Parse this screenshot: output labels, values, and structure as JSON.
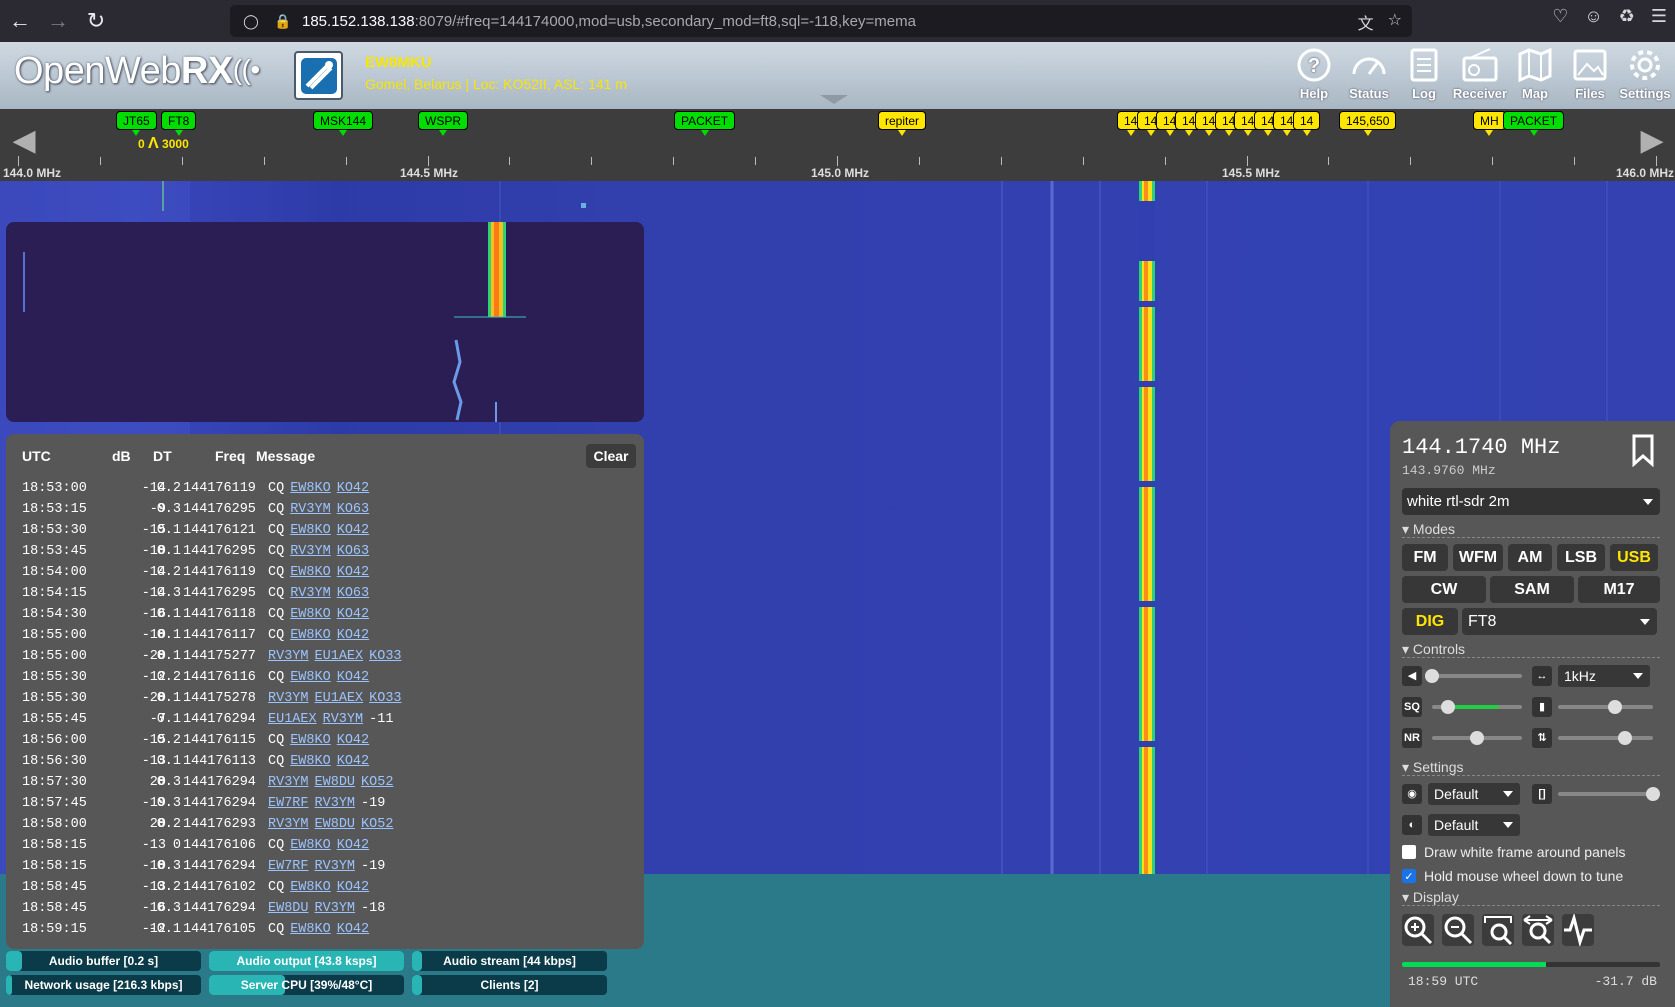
{
  "browser": {
    "url_host": "185.152.138.138",
    "url_rest": ":8079/#freq=144174000,mod=usb,secondary_mod=ft8,sql=-118,key=mema"
  },
  "header": {
    "logo_open": "Open",
    "logo_web": "Web",
    "logo_rx": "RX",
    "receiver_name": "EW8MKU",
    "receiver_location": "Gomel, Belarus | Loc: KO52II, ASL: 141 m",
    "buttons": [
      {
        "label": "Help",
        "icon": "help-icon"
      },
      {
        "label": "Status",
        "icon": "status-gauge-icon"
      },
      {
        "label": "Log",
        "icon": "log-icon"
      },
      {
        "label": "Receiver",
        "icon": "receiver-radio-icon"
      },
      {
        "label": "Map",
        "icon": "map-icon"
      },
      {
        "label": "Files",
        "icon": "files-image-icon"
      },
      {
        "label": "Settings",
        "icon": "settings-gear-icon"
      }
    ]
  },
  "scale": {
    "labels": [
      "144.0 MHz",
      "144.5 MHz",
      "145.0 MHz",
      "145.5 MHz",
      "146.0 MHz"
    ],
    "passband_low": "0",
    "passband_high": "3000",
    "bookmarks": [
      {
        "label": "JT65",
        "color": "green"
      },
      {
        "label": "FT8",
        "color": "green"
      },
      {
        "label": "MSK144",
        "color": "green"
      },
      {
        "label": "WSPR",
        "color": "green"
      },
      {
        "label": "PACKET",
        "color": "green"
      },
      {
        "label": "repiter",
        "color": "yellow"
      },
      {
        "label": "14",
        "color": "yellow"
      },
      {
        "label": "14",
        "color": "yellow"
      },
      {
        "label": "14",
        "color": "yellow"
      },
      {
        "label": "14",
        "color": "yellow"
      },
      {
        "label": "14",
        "color": "yellow"
      },
      {
        "label": "14",
        "color": "yellow"
      },
      {
        "label": "14",
        "color": "yellow"
      },
      {
        "label": "14",
        "color": "yellow"
      },
      {
        "label": "14",
        "color": "yellow"
      },
      {
        "label": "14",
        "color": "yellow"
      },
      {
        "label": "145,650",
        "color": "yellow"
      },
      {
        "label": "MH",
        "color": "yellow"
      },
      {
        "label": "PACKET",
        "color": "green"
      }
    ]
  },
  "decode": {
    "headers": {
      "utc": "UTC",
      "db": "dB",
      "dt": "DT",
      "freq": "Freq",
      "message": "Message"
    },
    "clear_label": "Clear",
    "rows": [
      {
        "utc": "18:53:00",
        "db": "-14",
        "dt": "0.2",
        "freq": "144176119",
        "msg": [
          {
            "t": "CQ",
            "link": false
          },
          {
            "t": "EW8KO",
            "link": true
          },
          {
            "t": "KO42",
            "link": true
          }
        ]
      },
      {
        "utc": "18:53:15",
        "db": "-9",
        "dt": "0.3",
        "freq": "144176295",
        "msg": [
          {
            "t": "CQ",
            "link": false
          },
          {
            "t": "RV3YM",
            "link": true
          },
          {
            "t": "KO63",
            "link": true
          }
        ]
      },
      {
        "utc": "18:53:30",
        "db": "-15",
        "dt": "0.1",
        "freq": "144176121",
        "msg": [
          {
            "t": "CQ",
            "link": false
          },
          {
            "t": "EW8KO",
            "link": true
          },
          {
            "t": "KO42",
            "link": true
          }
        ]
      },
      {
        "utc": "18:53:45",
        "db": "-10",
        "dt": "0.1",
        "freq": "144176295",
        "msg": [
          {
            "t": "CQ",
            "link": false
          },
          {
            "t": "RV3YM",
            "link": true
          },
          {
            "t": "KO63",
            "link": true
          }
        ]
      },
      {
        "utc": "18:54:00",
        "db": "-14",
        "dt": "0.2",
        "freq": "144176119",
        "msg": [
          {
            "t": "CQ",
            "link": false
          },
          {
            "t": "EW8KO",
            "link": true
          },
          {
            "t": "KO42",
            "link": true
          }
        ]
      },
      {
        "utc": "18:54:15",
        "db": "-14",
        "dt": "0.3",
        "freq": "144176295",
        "msg": [
          {
            "t": "CQ",
            "link": false
          },
          {
            "t": "RV3YM",
            "link": true
          },
          {
            "t": "KO63",
            "link": true
          }
        ]
      },
      {
        "utc": "18:54:30",
        "db": "-16",
        "dt": "0.1",
        "freq": "144176118",
        "msg": [
          {
            "t": "CQ",
            "link": false
          },
          {
            "t": "EW8KO",
            "link": true
          },
          {
            "t": "KO42",
            "link": true
          }
        ]
      },
      {
        "utc": "18:55:00",
        "db": "-10",
        "dt": "0.1",
        "freq": "144176117",
        "msg": [
          {
            "t": "CQ",
            "link": false
          },
          {
            "t": "EW8KO",
            "link": true
          },
          {
            "t": "KO42",
            "link": true
          }
        ]
      },
      {
        "utc": "18:55:00",
        "db": "-20",
        "dt": "0.1",
        "freq": "144175277",
        "msg": [
          {
            "t": "RV3YM",
            "link": true
          },
          {
            "t": "EU1AEX",
            "link": true
          },
          {
            "t": "KO33",
            "link": true
          }
        ]
      },
      {
        "utc": "18:55:30",
        "db": "-12",
        "dt": "0.2",
        "freq": "144176116",
        "msg": [
          {
            "t": "CQ",
            "link": false
          },
          {
            "t": "EW8KO",
            "link": true
          },
          {
            "t": "KO42",
            "link": true
          }
        ]
      },
      {
        "utc": "18:55:30",
        "db": "-20",
        "dt": "0.1",
        "freq": "144175278",
        "msg": [
          {
            "t": "RV3YM",
            "link": true
          },
          {
            "t": "EU1AEX",
            "link": true
          },
          {
            "t": "KO33",
            "link": true
          }
        ]
      },
      {
        "utc": "18:55:45",
        "db": "-7",
        "dt": "0.1",
        "freq": "144176294",
        "msg": [
          {
            "t": "EU1AEX",
            "link": true
          },
          {
            "t": "RV3YM",
            "link": true
          },
          {
            "t": "-11",
            "link": false
          }
        ]
      },
      {
        "utc": "18:56:00",
        "db": "-15",
        "dt": "0.2",
        "freq": "144176115",
        "msg": [
          {
            "t": "CQ",
            "link": false
          },
          {
            "t": "EW8KO",
            "link": true
          },
          {
            "t": "KO42",
            "link": true
          }
        ]
      },
      {
        "utc": "18:56:30",
        "db": "-13",
        "dt": "0.1",
        "freq": "144176113",
        "msg": [
          {
            "t": "CQ",
            "link": false
          },
          {
            "t": "EW8KO",
            "link": true
          },
          {
            "t": "KO42",
            "link": true
          }
        ]
      },
      {
        "utc": "18:57:30",
        "db": "20",
        "dt": "0.3",
        "freq": "144176294",
        "msg": [
          {
            "t": "RV3YM",
            "link": true
          },
          {
            "t": "EW8DU",
            "link": true
          },
          {
            "t": "KO52",
            "link": true
          }
        ]
      },
      {
        "utc": "18:57:45",
        "db": "-19",
        "dt": "0.3",
        "freq": "144176294",
        "msg": [
          {
            "t": "EW7RF",
            "link": true
          },
          {
            "t": "RV3YM",
            "link": true
          },
          {
            "t": "-19",
            "link": false
          }
        ]
      },
      {
        "utc": "18:58:00",
        "db": "20",
        "dt": "0.2",
        "freq": "144176293",
        "msg": [
          {
            "t": "RV3YM",
            "link": true
          },
          {
            "t": "EW8DU",
            "link": true
          },
          {
            "t": "KO52",
            "link": true
          }
        ]
      },
      {
        "utc": "18:58:15",
        "db": "-13",
        "dt": "0",
        "freq": "144176106",
        "msg": [
          {
            "t": "CQ",
            "link": false
          },
          {
            "t": "EW8KO",
            "link": true
          },
          {
            "t": "KO42",
            "link": true
          }
        ]
      },
      {
        "utc": "18:58:15",
        "db": "-10",
        "dt": "0.3",
        "freq": "144176294",
        "msg": [
          {
            "t": "EW7RF",
            "link": true
          },
          {
            "t": "RV3YM",
            "link": true
          },
          {
            "t": "-19",
            "link": false
          }
        ]
      },
      {
        "utc": "18:58:45",
        "db": "-13",
        "dt": "0.2",
        "freq": "144176102",
        "msg": [
          {
            "t": "CQ",
            "link": false
          },
          {
            "t": "EW8KO",
            "link": true
          },
          {
            "t": "KO42",
            "link": true
          }
        ]
      },
      {
        "utc": "18:58:45",
        "db": "-16",
        "dt": "0.3",
        "freq": "144176294",
        "msg": [
          {
            "t": "EW8DU",
            "link": true
          },
          {
            "t": "RV3YM",
            "link": true
          },
          {
            "t": "-18",
            "link": false
          }
        ]
      },
      {
        "utc": "18:59:15",
        "db": "-12",
        "dt": "-0.1",
        "freq": "144176105",
        "msg": [
          {
            "t": "CQ",
            "link": false
          },
          {
            "t": "EW8KO",
            "link": true
          },
          {
            "t": "KO42",
            "link": true
          }
        ]
      }
    ]
  },
  "statusbars": [
    {
      "label": "Audio buffer [0.2 s]",
      "fill": 0.08
    },
    {
      "label": "Audio output [43.8 ksps]",
      "fill": 1.0
    },
    {
      "label": "Audio stream [44 kbps]",
      "fill": 0.05
    },
    {
      "label": "Network usage [216.3 kbps]",
      "fill": 0.03
    },
    {
      "label": "Server CPU [39%/48°C]",
      "fill": 0.39
    },
    {
      "label": "Clients [2]",
      "fill": 0.05
    }
  ],
  "receiver": {
    "frequency": "144.1740 MHz",
    "offset_frequency": "143.9760 MHz",
    "profile": "white rtl-sdr 2m",
    "sections": {
      "modes": "Modes",
      "controls": "Controls",
      "settings": "Settings",
      "display": "Display"
    },
    "modes_row1": [
      "FM",
      "WFM",
      "AM",
      "LSB",
      "USB"
    ],
    "modes_row2": [
      "CW",
      "SAM",
      "M17"
    ],
    "active_mode": "USB",
    "dig_label": "DIG",
    "dig_mode": "FT8",
    "step_select": "1kHz",
    "volume": 0.0,
    "squelch": 0.18,
    "nr": 0.5,
    "agc": 0.6,
    "gain": 0.7,
    "zoom_slider": 1.0,
    "theme_select": "Default",
    "contrast_select": "Default",
    "checkbox_white_frame": "Draw white frame around panels",
    "checkbox_white_frame_checked": false,
    "checkbox_wheel_tune": "Hold mouse wheel down to tune",
    "checkbox_wheel_tune_checked": true,
    "display_buttons": [
      "zoom-in-icon",
      "zoom-out-icon",
      "zoom-to-passband-icon",
      "zoom-fit-icon",
      "spectrum-toggle-icon"
    ],
    "signal_level_fill": 0.56,
    "clock": "18:59 UTC",
    "level_db": "-31.7 dB"
  }
}
